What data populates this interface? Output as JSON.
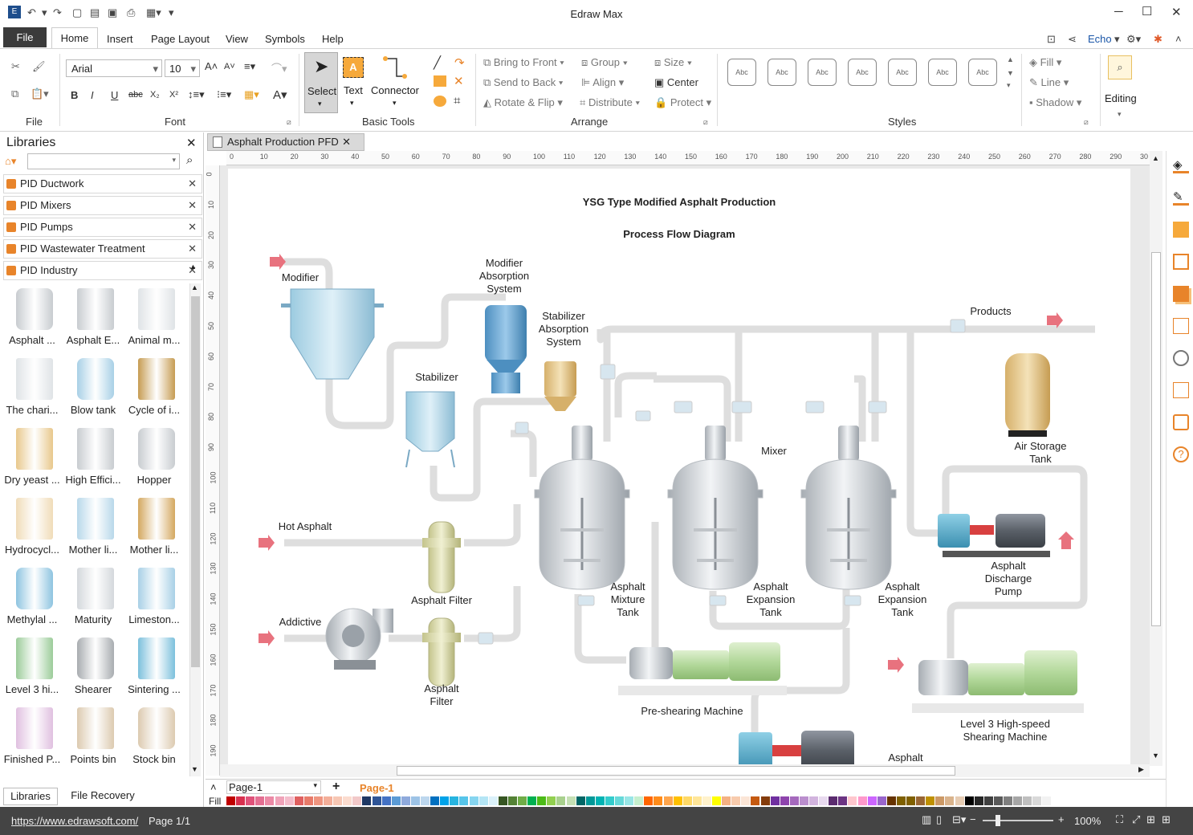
{
  "app": {
    "title": "Edraw Max"
  },
  "menu": {
    "file": "File",
    "home": "Home",
    "insert": "Insert",
    "page_layout": "Page Layout",
    "view": "View",
    "symbols": "Symbols",
    "help": "Help",
    "user": "Echo"
  },
  "ribbon": {
    "font_name": "Arial",
    "font_size": "10",
    "groups": {
      "file": "File",
      "font": "Font",
      "basic_tools": "Basic Tools",
      "arrange": "Arrange",
      "styles": "Styles",
      "editing": "Editing"
    },
    "tools": {
      "select": "Select",
      "text": "Text",
      "connector": "Connector"
    },
    "arrange": {
      "bring_front": "Bring to Front",
      "send_back": "Send to Back",
      "rotate_flip": "Rotate & Flip",
      "group": "Group",
      "align": "Align",
      "distribute": "Distribute",
      "size": "Size",
      "center": "Center",
      "protect": "Protect"
    },
    "format": {
      "fill": "Fill",
      "line": "Line",
      "shadow": "Shadow"
    },
    "style_label": "Abc"
  },
  "library": {
    "title": "Libraries",
    "categories": [
      "PID Ductwork",
      "PID Mixers",
      "PID Pumps",
      "PID Wastewater Treatment",
      "PID Industry"
    ],
    "shapes": [
      "Asphalt ...",
      "Asphalt E...",
      "Animal m...",
      "The chari...",
      "Blow tank",
      "Cycle of i...",
      "Dry yeast ...",
      "High Effici...",
      "Hopper",
      "Hydrocycl...",
      "Mother li...",
      "Mother li...",
      "Methylal ...",
      "Maturity",
      "Limeston...",
      "Level 3 hi...",
      "Shearer",
      "Sintering ...",
      "Finished P...",
      "Points bin",
      "Stock bin"
    ],
    "bottom_tabs": [
      "Libraries",
      "File Recovery"
    ]
  },
  "document": {
    "tab": "Asphalt Production PFD",
    "page_name": "Page-1",
    "page_tab": "Page-1",
    "fill_label": "Fill"
  },
  "ruler": {
    "h": [
      "0",
      "10",
      "20",
      "30",
      "40",
      "50",
      "60",
      "70",
      "80",
      "90",
      "100",
      "110",
      "120",
      "130",
      "140",
      "150",
      "160",
      "170",
      "180",
      "190",
      "200",
      "210",
      "220",
      "230",
      "240",
      "250",
      "260",
      "270",
      "280",
      "290",
      "30"
    ],
    "v": [
      "0",
      "10",
      "20",
      "30",
      "40",
      "50",
      "60",
      "70",
      "80",
      "90",
      "100",
      "110",
      "120",
      "130",
      "140",
      "150",
      "160",
      "170",
      "180",
      "190"
    ]
  },
  "diagram": {
    "title_line1": "YSG Type Modified Asphalt Production",
    "title_line2": "Process Flow Diagram",
    "labels": {
      "modifier": "Modifier",
      "modifier_absorption": [
        "Modifier",
        "Absorption",
        "System"
      ],
      "stabilizer_absorption": [
        "Stabilizer",
        "Absorption",
        "System"
      ],
      "stabilizer": "Stabilizer",
      "products": "Products",
      "mixer": "Mixer",
      "air_storage": [
        "Air Storage",
        "Tank"
      ],
      "hot_asphalt": "Hot Asphalt",
      "asphalt_filter_1": "Asphalt Filter",
      "addictive": "Addictive",
      "asphalt_filter_2": [
        "Asphalt",
        "Filter"
      ],
      "mixture_tank": [
        "Asphalt",
        "Mixture",
        "Tank"
      ],
      "expansion_tank_1": [
        "Asphalt",
        "Expansion",
        "Tank"
      ],
      "expansion_tank_2": [
        "Asphalt",
        "Expansion",
        "Tank"
      ],
      "discharge_pump": [
        "Asphalt",
        "Discharge",
        "Pump"
      ],
      "preshearing": "Pre-shearing Machine",
      "level3": [
        "Level 3 High-speed",
        "Shearing Machine"
      ],
      "asphalt_bottom": "Asphalt"
    }
  },
  "status": {
    "url": "https://www.edrawsoft.com/",
    "page": "Page 1/1",
    "zoom": "100%"
  },
  "palette": [
    "#c00000",
    "#d9304f",
    "#e0527a",
    "#e46f92",
    "#ec8aa6",
    "#f0a3b9",
    "#f4bccb",
    "#e06060",
    "#e87b6a",
    "#ef9580",
    "#f4af9a",
    "#f7c7b4",
    "#fbdccf",
    "#f2c9c9",
    "#1f3864",
    "#2f5597",
    "#4472c4",
    "#5b9bd5",
    "#8faadc",
    "#9dc3e6",
    "#bdd7ee",
    "#0070c0",
    "#00a2e8",
    "#27b4e0",
    "#56c5ea",
    "#86d5f0",
    "#b4e5f5",
    "#dbf1fa",
    "#375623",
    "#548235",
    "#70ad47",
    "#00b050",
    "#4cbb17",
    "#92d050",
    "#a9d18e",
    "#c5e0b4",
    "#006666",
    "#009999",
    "#00b3b3",
    "#33cccc",
    "#66d9d9",
    "#99e6e6",
    "#c6efce",
    "#ff6600",
    "#ff8c1a",
    "#ffa64d",
    "#ffc000",
    "#ffd966",
    "#ffe699",
    "#fff2cc",
    "#ffff00",
    "#f4b183",
    "#f8cbad",
    "#fbe5d6",
    "#c55a11",
    "#843c0c",
    "#7030a0",
    "#8e44ad",
    "#a569bd",
    "#bb8fce",
    "#d2b4de",
    "#e8daef",
    "#5b2c6f",
    "#6c3483",
    "#ffc7ce",
    "#ff99cc",
    "#cc66ff",
    "#9966cc",
    "#663300",
    "#7f6000",
    "#806000",
    "#996633",
    "#bf9000",
    "#cc9966",
    "#d9b38c",
    "#e6ccb3",
    "#000000",
    "#262626",
    "#404040",
    "#595959",
    "#7f7f7f",
    "#a6a6a6",
    "#bfbfbf",
    "#d9d9d9",
    "#f2f2f2",
    "#ffffff"
  ]
}
